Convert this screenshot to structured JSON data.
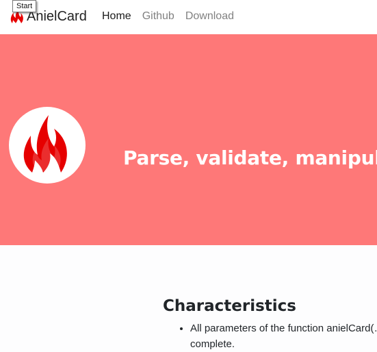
{
  "tooltip": {
    "label": "Start"
  },
  "navbar": {
    "brand": "AnielCard",
    "links": [
      {
        "label": "Home",
        "active": true
      },
      {
        "label": "Github",
        "active": false
      },
      {
        "label": "Download",
        "active": false
      }
    ]
  },
  "hero": {
    "logo_icon": "flame-icon",
    "tagline": "Parse, validate, manipulate, and display",
    "background": "#fe7878"
  },
  "characteristics": {
    "title": "Characteristics",
    "items": [
      "All parameters of the function anielCard(…) are complete."
    ]
  },
  "colors": {
    "flame": "#e60000",
    "hero_bg": "#fe7878"
  }
}
